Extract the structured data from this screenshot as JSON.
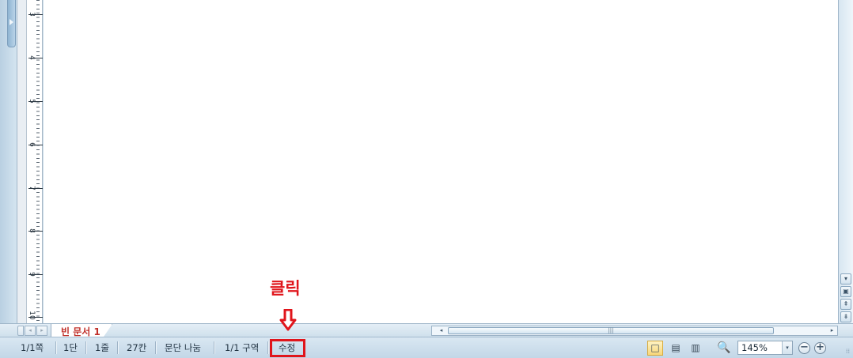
{
  "ruler": {
    "numbers": [
      "3",
      "4",
      "5",
      "6",
      "7",
      "8",
      "9",
      "10"
    ]
  },
  "tabs": {
    "nav_first": "◂",
    "nav_prev": "▸",
    "active_document": "빈 문서 1"
  },
  "hscrollbar": {
    "left_arrow": "◂",
    "right_arrow": "▸",
    "thumb_grip": "|||"
  },
  "vscrollbar": {
    "down": "▾",
    "page_view": "▣",
    "prev_page": "⇞",
    "next_page": "⇟"
  },
  "status": {
    "page": "1/1쪽",
    "column": "1단",
    "line": "1줄",
    "col_pos": "27칸",
    "break": "문단 나눔",
    "section": "1/1 구역",
    "mode": "수정"
  },
  "view": {
    "normal_icon": "□",
    "layout_icon": "▤",
    "page_icon": "▥"
  },
  "zoom": {
    "icon": "🔍",
    "value": "145%",
    "dropdown_arrow": "▾",
    "zoom_out": "−",
    "zoom_in": "+"
  },
  "annotation": {
    "label": "클릭"
  },
  "colors": {
    "annotation": "#e0151b",
    "active_tab_text": "#c0302a"
  }
}
